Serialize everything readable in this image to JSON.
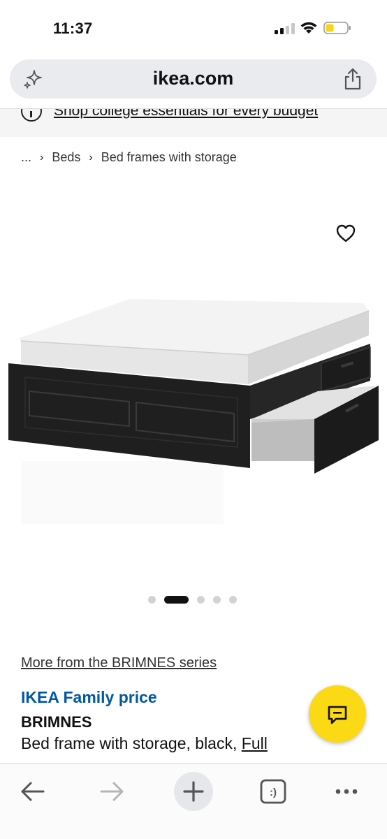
{
  "status_bar": {
    "time": "11:37"
  },
  "address_bar": {
    "url": "ikea.com"
  },
  "promo": {
    "text": "Shop college essentials for every budget"
  },
  "breadcrumb": {
    "items": [
      "...",
      "Beds",
      "Bed frames with storage"
    ]
  },
  "carousel": {
    "total": 5,
    "active_index": 1
  },
  "product": {
    "series_link": "More from the BRIMNES series",
    "family_price_label": "IKEA Family price",
    "name": "BRIMNES",
    "description": "Bed frame with storage, black, ",
    "size": "Full"
  },
  "colors": {
    "ikea_blue": "#0058a3",
    "chat_yellow": "#fbd914",
    "battery_yellow": "#f7d51d"
  },
  "icons": {
    "address_left": "sparkle-icon",
    "address_right": "share-icon",
    "image_action": "heart-icon",
    "chat": "chat-icon",
    "toolbar": [
      "back-arrow-icon",
      "forward-arrow-icon",
      "plus-icon",
      "tabs-icon",
      "more-icon"
    ]
  }
}
